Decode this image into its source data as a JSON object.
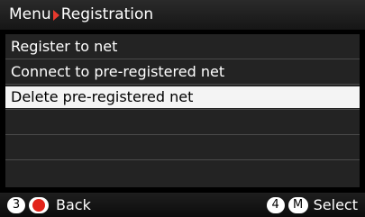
{
  "header": {
    "menu_label": "Menu",
    "title": "Registration",
    "accent_color": "#e83a2e"
  },
  "menu": {
    "items": [
      {
        "label": "Register to net",
        "selected": false
      },
      {
        "label": "Connect to pre-registered net",
        "selected": false
      },
      {
        "label": "Delete pre-registered net",
        "selected": true
      }
    ]
  },
  "footer": {
    "back_key": "3",
    "back_icon": "record-dot-icon",
    "back_label": "Back",
    "select_key": "4",
    "select_icon": "m-key",
    "select_icon_text": "M",
    "select_label": "Select"
  }
}
